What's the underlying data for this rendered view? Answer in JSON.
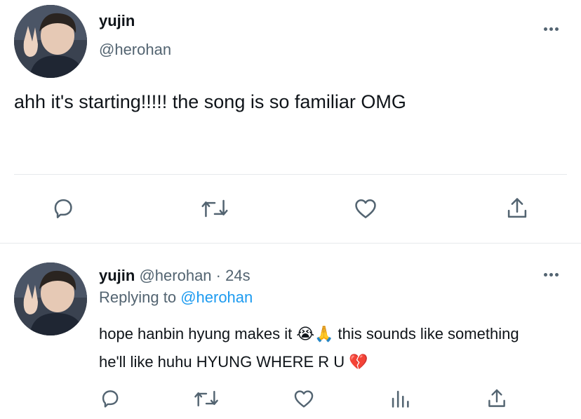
{
  "main_tweet": {
    "display_name": "yujin",
    "handle": "@herohan",
    "text": "ahh it's starting!!!!! the song is so familiar OMG",
    "actions": [
      "reply-icon",
      "retweet-icon",
      "like-icon",
      "share-icon"
    ]
  },
  "reply_tweet": {
    "display_name": "yujin",
    "handle": "@herohan",
    "separator": " · ",
    "time": "24s",
    "replying_prefix": "Replying to ",
    "replying_handle": "@herohan",
    "text_part1": "hope hanbin hyung makes it ",
    "emoji1": "😭🙏",
    "text_part2": " this sounds like something he'll like huhu HYUNG WHERE R U ",
    "emoji2": "💔",
    "actions": [
      "reply-icon",
      "retweet-icon",
      "like-icon",
      "analytics-icon",
      "share-icon"
    ]
  },
  "colors": {
    "text": "#0f1419",
    "muted": "#536471",
    "link": "#1d9bf0",
    "divider": "#e6e9ec"
  }
}
